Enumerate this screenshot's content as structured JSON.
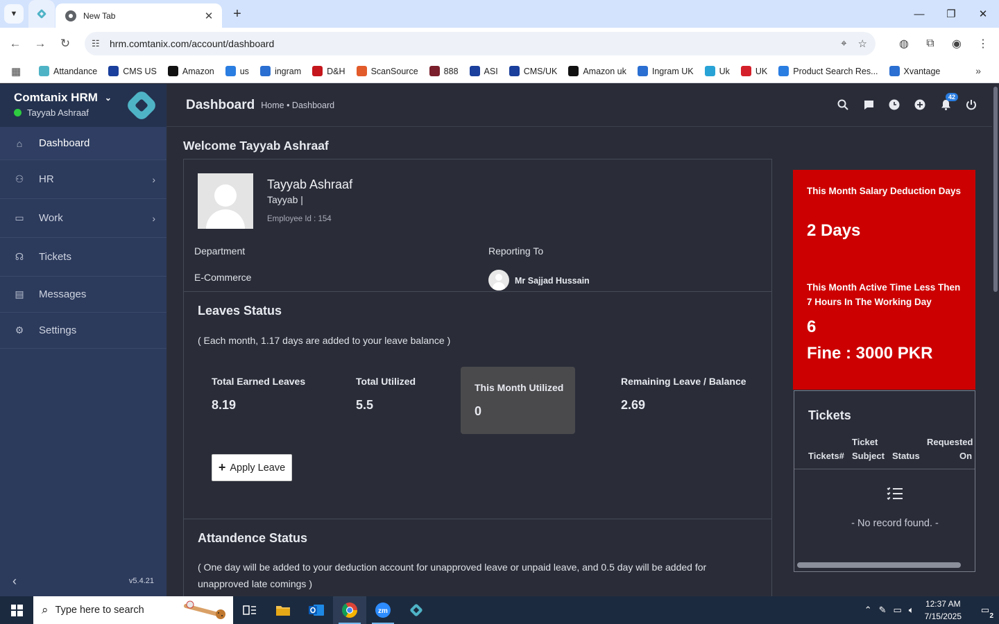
{
  "browser": {
    "tab_title": "New Tab",
    "url": "hrm.comtanix.com/account/dashboard",
    "bookmarks": [
      {
        "label": "Attandance",
        "color": "#4fb3c6"
      },
      {
        "label": "CMS US",
        "color": "#1a3f9c"
      },
      {
        "label": "Amazon",
        "color": "#111111"
      },
      {
        "label": "us",
        "color": "#2a7de1"
      },
      {
        "label": "ingram",
        "color": "#2a6fd1"
      },
      {
        "label": "D&H",
        "color": "#c4161c"
      },
      {
        "label": "ScanSource",
        "color": "#e25b2a"
      },
      {
        "label": "888",
        "color": "#7a1f2b"
      },
      {
        "label": "ASI",
        "color": "#1a3f9c"
      },
      {
        "label": "CMS/UK",
        "color": "#1a3f9c"
      },
      {
        "label": "Amazon uk",
        "color": "#111111"
      },
      {
        "label": "Ingram UK",
        "color": "#2a6fd1"
      },
      {
        "label": "Uk",
        "color": "#29a3d6"
      },
      {
        "label": "UK",
        "color": "#d4202a"
      },
      {
        "label": "Product Search Res...",
        "color": "#2a7de1"
      },
      {
        "label": "Xvantage",
        "color": "#2a6fd1"
      }
    ]
  },
  "sidebar": {
    "brand": "Comtanix HRM",
    "user": "Tayyab Ashraaf",
    "items": [
      {
        "label": "Dashboard"
      },
      {
        "label": "HR"
      },
      {
        "label": "Work"
      },
      {
        "label": "Tickets"
      },
      {
        "label": "Messages"
      },
      {
        "label": "Settings"
      }
    ],
    "version": "v5.4.21"
  },
  "header": {
    "title": "Dashboard",
    "breadcrumb": "Home • Dashboard",
    "notification_count": "42"
  },
  "main": {
    "welcome": "Welcome Tayyab Ashraaf",
    "profile": {
      "name": "Tayyab Ashraaf",
      "subtitle": "Tayyab |",
      "employee_id": "Employee Id : 154",
      "department_label": "Department",
      "department": "E-Commerce",
      "reporting_label": "Reporting To",
      "reporting_to": "Mr Sajjad Hussain"
    },
    "leaves": {
      "title": "Leaves Status",
      "note": "( Each month, 1.17 days are added to your leave balance )",
      "stats": [
        {
          "label": "Total Earned Leaves",
          "value": "8.19"
        },
        {
          "label": "Total Utilized",
          "value": "5.5"
        },
        {
          "label": "This Month Utilized",
          "value": "0"
        },
        {
          "label": "Remaining Leave / Balance",
          "value": "2.69"
        }
      ],
      "apply_label": "Apply Leave"
    },
    "attendance": {
      "title": "Attandence Status",
      "note": "( One day will be added to your deduction account for unapproved leave or unpaid leave, and 0.5 day will be added for unapproved late comings )"
    }
  },
  "right": {
    "salary_label": "This Month Salary Deduction Days",
    "salary_value": "2 Days",
    "active_label": "This Month Active Time Less Then 7 Hours In The Working Day",
    "active_value": "6",
    "fine": "Fine : 3000 PKR",
    "accent": "#cc0000",
    "tickets": {
      "title": "Tickets",
      "col1": "Tickets#",
      "col2a": "Ticket",
      "col2b": "Subject",
      "col3": "Status",
      "col4a": "Requested",
      "col4b": "On",
      "empty": "- No record found. -"
    }
  },
  "taskbar": {
    "search_placeholder": "Type here to search",
    "time": "12:37 AM",
    "date": "7/15/2025",
    "notification_count": "2"
  }
}
